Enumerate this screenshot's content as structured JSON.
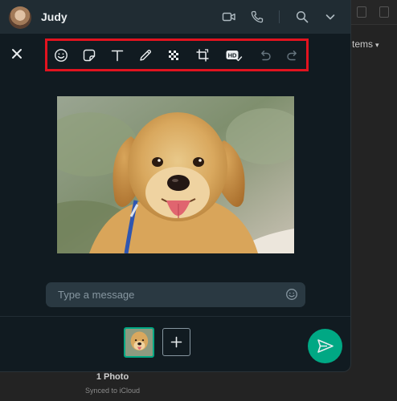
{
  "chat": {
    "contact_name": "Judy"
  },
  "header": {
    "icons": [
      "video-call-icon",
      "voice-call-icon",
      "search-icon",
      "chevron-down-icon"
    ]
  },
  "editor": {
    "tools": [
      "emoji-icon",
      "sticker-icon",
      "text-icon",
      "draw-icon",
      "blur-icon",
      "crop-icon",
      "hd-quality-icon",
      "undo-icon",
      "redo-icon"
    ],
    "hd_label": "HD"
  },
  "message": {
    "placeholder": "Type a message"
  },
  "background": {
    "items_label": "tems",
    "photo_count": "1 Photo",
    "sync_status": "Synced to iCloud"
  },
  "colors": {
    "accent": "#00a884",
    "highlight_border": "#e2131f",
    "panel": "#111b21",
    "header": "#202c33"
  }
}
